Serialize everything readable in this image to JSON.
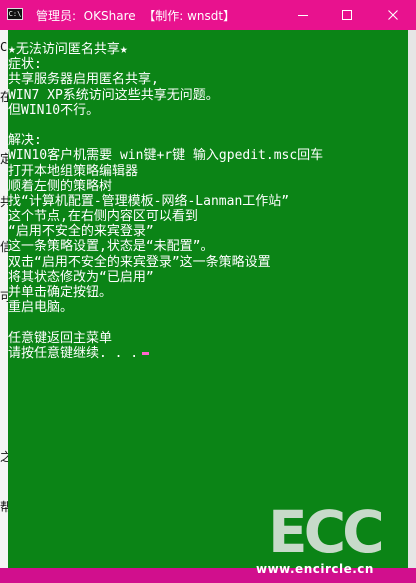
{
  "window": {
    "title": "管理员:  OKShare  【制作: wnsdt】",
    "icon_label": "C:\\",
    "controls": {
      "minimize_icon": "minimize-icon",
      "maximize_icon": "maximize-icon",
      "close_icon": "close-icon"
    }
  },
  "colors": {
    "titlebar": "#e8128e",
    "console_background": "#0b8416",
    "console_text": "#ffffff",
    "cursor": "#ff66cc"
  },
  "left_strip_glyphs": [
    "C",
    "在",
    "定",
    "共",
    "信",
    "可",
    "之",
    "帮"
  ],
  "console": {
    "lines": [
      "★无法访问匿名共享★",
      "症状:",
      "共享服务器启用匿名共享,",
      "WIN7 XP系统访问这些共享无问题。",
      "但WIN10不行。",
      "",
      "解决:",
      "WIN10客户机需要 win键+r键 输入gpedit.msc回车",
      "打开本地组策略编辑器",
      "顺着左侧的策略树",
      "找“计算机配置-管理模板-网络-Lanman工作站”",
      "这个节点,在右侧内容区可以看到",
      "“启用不安全的来宾登录”",
      "这一条策略设置,状态是“未配置”。",
      "双击“启用不安全的来宾登录”这一条策略设置",
      "将其状态修改为“已启用”",
      "并单击确定按钮。",
      "重启电脑。",
      "",
      "任意键返回主菜单"
    ],
    "prompt": "请按任意键继续. . ."
  },
  "watermark": {
    "logo_text": "ECC",
    "url": "www.encircle.cn"
  }
}
